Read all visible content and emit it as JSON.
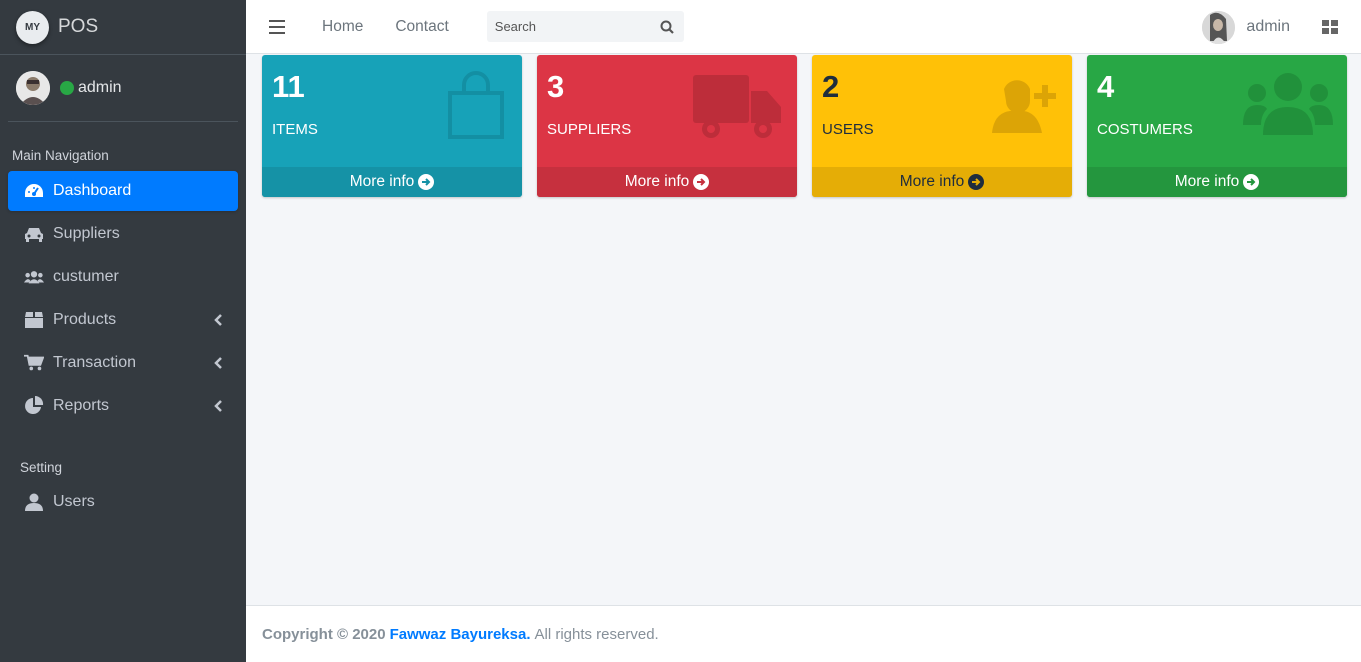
{
  "brand": {
    "logo_text": "MY",
    "name": "POS"
  },
  "user_panel": {
    "name": "admin"
  },
  "sidebar": {
    "main_header": "Main Navigation",
    "items": [
      {
        "label": "Dashboard",
        "icon": "dashboard-icon",
        "active": true
      },
      {
        "label": "Suppliers",
        "icon": "truck-icon"
      },
      {
        "label": "custumer",
        "icon": "users-icon"
      },
      {
        "label": "Products",
        "icon": "box-icon"
      },
      {
        "label": "Transaction",
        "icon": "cart-icon"
      },
      {
        "label": "Reports",
        "icon": "pie-chart-icon"
      }
    ],
    "setting_header": "Setting",
    "setting_items": [
      {
        "label": "Users",
        "icon": "user-icon"
      }
    ]
  },
  "topbar": {
    "links": [
      "Home",
      "Contact"
    ],
    "search_placeholder": "Search",
    "user_name": "admin"
  },
  "boxes": [
    {
      "value": "11",
      "label": "ITEMS",
      "more": "More info",
      "color": "#17a2b8",
      "icon": "shopping-bag-icon"
    },
    {
      "value": "3",
      "label": "SUPPLIERS",
      "more": "More info",
      "color": "#dc3545",
      "icon": "truck-icon"
    },
    {
      "value": "2",
      "label": "USERS",
      "more": "More info",
      "color": "#ffc107",
      "icon": "user-plus-icon"
    },
    {
      "value": "4",
      "label": "COSTUMERS",
      "more": "More info",
      "color": "#28a745",
      "icon": "users-icon"
    }
  ],
  "footer": {
    "copyright": "Copyright © 2020",
    "author": "Fawwaz Bayureksa.",
    "rights": "All rights reserved."
  }
}
